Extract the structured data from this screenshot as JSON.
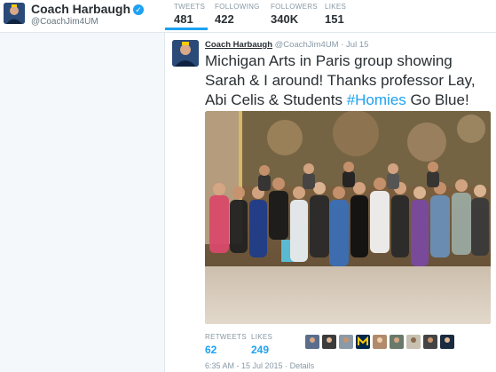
{
  "profile": {
    "name": "Coach Harbaugh",
    "handle": "@CoachJim4UM"
  },
  "stats": [
    {
      "label": "TWEETS",
      "value": "481"
    },
    {
      "label": "FOLLOWING",
      "value": "422"
    },
    {
      "label": "FOLLOWERS",
      "value": "340K"
    },
    {
      "label": "LIKES",
      "value": "151"
    }
  ],
  "tweet": {
    "author_name": "Coach Harbaugh",
    "author_handle": "@CoachJim4UM",
    "separator": "·",
    "time": "Jul 15",
    "text_main": "Michigan Arts in Paris group showing Sarah & I around! Thanks professor Lay, Abi Celis & Students ",
    "hashtag": "#Homies",
    "text_tail": " Go Blue!",
    "retweets_label": "RETWEETS",
    "retweets_value": "62",
    "likes_label": "LIKES",
    "likes_value": "249",
    "timestamp": "6:35 AM - 15 Jul 2015",
    "details_sep": "·",
    "details_label": "Details"
  },
  "colors": {
    "accent": "#1da1f2",
    "michigan_blue": "#00274c",
    "michigan_maize": "#ffcb05"
  }
}
